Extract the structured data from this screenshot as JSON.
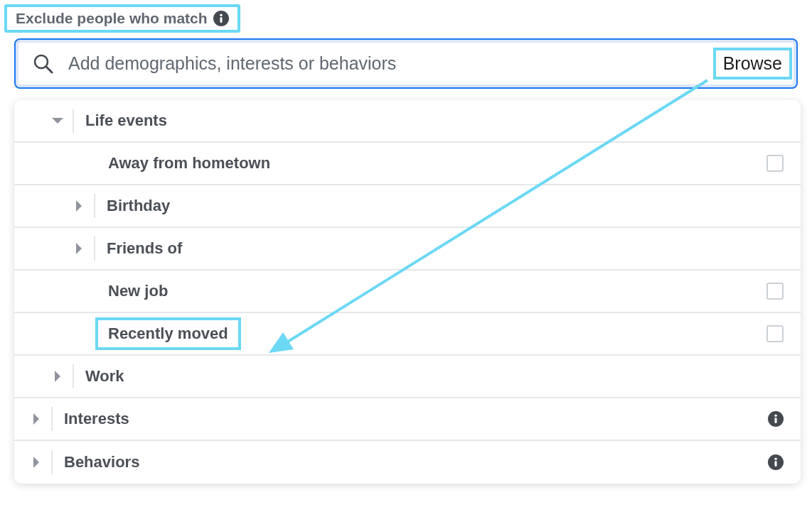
{
  "section_label": {
    "text": "Exclude people who match",
    "highlighted": true
  },
  "search": {
    "placeholder": "Add demographics, interests or behaviors",
    "browse": {
      "label": "Browse",
      "highlighted": true
    }
  },
  "tree": [
    {
      "children": [
        {
          "label": "Life events",
          "kind": "branch",
          "expanded": true,
          "highlighted": false,
          "children": [
            {
              "label": "Away from hometown",
              "kind": "checkbox",
              "checked": false,
              "highlighted": false
            },
            {
              "label": "Birthday",
              "kind": "branch",
              "expanded": false,
              "highlighted": false
            },
            {
              "label": "Friends of",
              "kind": "branch",
              "expanded": false,
              "highlighted": false
            },
            {
              "label": "New job",
              "kind": "checkbox",
              "checked": false,
              "highlighted": false
            },
            {
              "label": "Recently moved",
              "kind": "checkbox",
              "checked": false,
              "highlighted": true
            }
          ]
        },
        {
          "label": "Work",
          "kind": "branch",
          "expanded": false,
          "highlighted": false
        }
      ]
    },
    {
      "label": "Interests",
      "kind": "branch",
      "expanded": false,
      "info": true,
      "highlighted": false
    },
    {
      "label": "Behaviors",
      "kind": "branch",
      "expanded": false,
      "info": true,
      "highlighted": false
    }
  ],
  "annotation": {
    "kind": "arrow"
  }
}
